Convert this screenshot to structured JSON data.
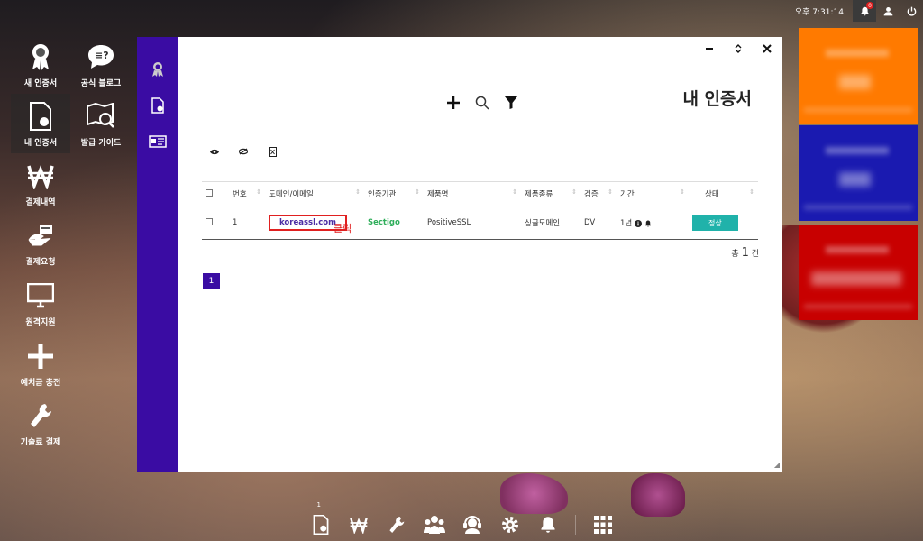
{
  "topbar": {
    "clock": "오후 7:31:14",
    "notification_count": "0"
  },
  "desktop": [
    {
      "label": "새 인증서",
      "icon": "award-icon"
    },
    {
      "label": "공식 블로그",
      "icon": "blog-icon"
    },
    {
      "label": "내 인증서",
      "icon": "certificate-icon"
    },
    {
      "label": "발급 가이드",
      "icon": "map-guide-icon"
    },
    {
      "label": "결제내역",
      "icon": "won-icon"
    },
    {
      "label": "결제요청",
      "icon": "payment-request-icon"
    },
    {
      "label": "원격지원",
      "icon": "monitor-icon"
    },
    {
      "label": "예치금 충전",
      "icon": "plus-icon"
    },
    {
      "label": "기술료 결제",
      "icon": "wrench-icon"
    }
  ],
  "window": {
    "title": "내 인증서",
    "table": {
      "headers": [
        "번호",
        "도메인/이메일",
        "인증기관",
        "제품명",
        "제품종류",
        "검증",
        "기간",
        "상태"
      ],
      "rows": [
        {
          "no": "1",
          "domain": "koreassl.com",
          "ca": "Sectigo",
          "product": "PositiveSSL",
          "type": "싱글도메인",
          "validation": "DV",
          "period": "1년",
          "status": "정상"
        }
      ]
    },
    "click_note": "클릭",
    "total_prefix": "총",
    "total_count": "1",
    "total_suffix": "건",
    "page": "1"
  },
  "tiles": [
    {
      "color": "#ff7a00"
    },
    {
      "color": "#1a1ab0"
    },
    {
      "color": "#c80000"
    }
  ],
  "taskbar": {
    "cert_count": "1"
  },
  "colors": {
    "accent": "#3a0ca3",
    "status": "#20b2aa",
    "highlight": "#e02020"
  }
}
